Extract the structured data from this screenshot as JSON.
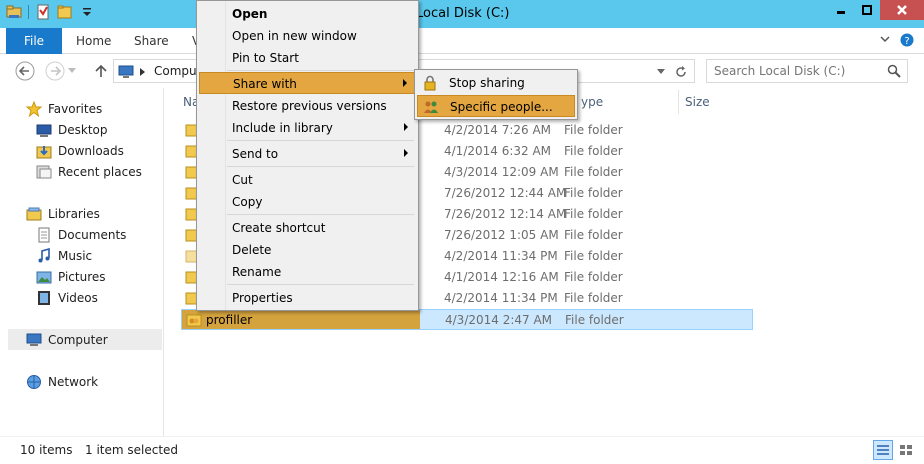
{
  "window": {
    "title": "Local Disk (C:)",
    "colors": {
      "titlebar": "#59c8ec",
      "file_tab": "#1979ca",
      "close_button": "#c75050",
      "menu_highlight": "#e3a640",
      "selection": "#cce8ff"
    }
  },
  "quick_access": {
    "icons": [
      "explorer-icon",
      "properties-icon",
      "new-folder-icon",
      "customize-dropdown-icon"
    ]
  },
  "ribbon": {
    "file_label": "File",
    "tabs": [
      "Home",
      "Share",
      "V"
    ]
  },
  "address": {
    "path": "Comput",
    "search_placeholder": "Search Local Disk (C:)"
  },
  "nav": {
    "favorites_label": "Favorites",
    "favorites": [
      "Desktop",
      "Downloads",
      "Recent places"
    ],
    "libraries_label": "Libraries",
    "libraries": [
      "Documents",
      "Music",
      "Pictures",
      "Videos"
    ],
    "computer_label": "Computer",
    "network_label": "Network"
  },
  "columns": {
    "name": "Na",
    "type": "ype",
    "size": "Size"
  },
  "files": [
    {
      "name": "",
      "date": "4/2/2014 7:26 AM",
      "type": "File folder"
    },
    {
      "name": "",
      "date": "4/1/2014 6:32 AM",
      "type": "File folder"
    },
    {
      "name": "",
      "date": "4/3/2014 12:09 AM",
      "type": "File folder"
    },
    {
      "name": "",
      "date": "7/26/2012 12:44 AM",
      "type": "File folder"
    },
    {
      "name": "",
      "date": "7/26/2012 12:14 AM",
      "type": "File folder"
    },
    {
      "name": "",
      "date": "7/26/2012 1:05 AM",
      "type": "File folder"
    },
    {
      "name": "",
      "date": "4/2/2014 11:34 PM",
      "type": "File folder"
    },
    {
      "name": "",
      "date": "4/1/2014 12:16 AM",
      "type": "File folder"
    },
    {
      "name": "",
      "date": "4/2/2014 11:34 PM",
      "type": "File folder"
    },
    {
      "name": "profiller",
      "date": "4/3/2014 2:47 AM",
      "type": "File folder"
    }
  ],
  "context_menu": {
    "open": "Open",
    "open_new_window": "Open in new window",
    "pin_to_start": "Pin to Start",
    "share_with": "Share with",
    "restore_previous": "Restore previous versions",
    "include_in_library": "Include in library",
    "send_to": "Send to",
    "cut": "Cut",
    "copy": "Copy",
    "create_shortcut": "Create shortcut",
    "delete": "Delete",
    "rename": "Rename",
    "properties": "Properties"
  },
  "share_submenu": {
    "stop_sharing": "Stop sharing",
    "specific_people": "Specific people..."
  },
  "status": {
    "item_count": "10 items",
    "selected": "1 item selected"
  }
}
